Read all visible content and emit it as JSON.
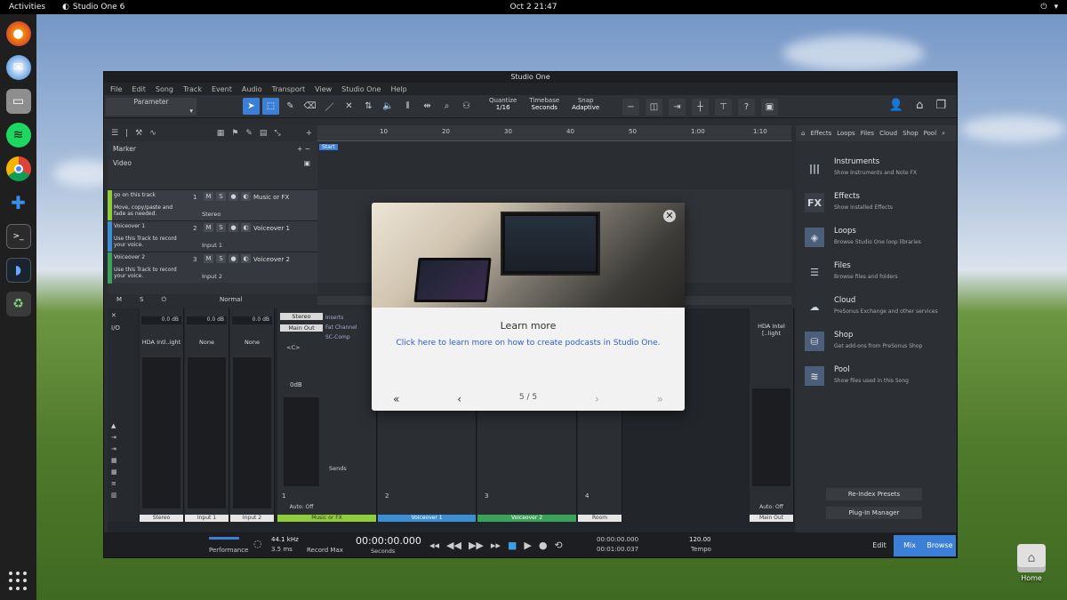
{
  "topbar": {
    "activities": "Activities",
    "app_name": "Studio One 6",
    "clock": "Oct 2  21:47"
  },
  "window": {
    "title": "Studio One",
    "menus": [
      "File",
      "Edit",
      "Song",
      "Track",
      "Event",
      "Audio",
      "Transport",
      "View",
      "Studio One",
      "Help"
    ],
    "parameter_label": "Parameter",
    "quantize": {
      "label": "Quantize",
      "value": "1/16"
    },
    "timebase": {
      "label": "Timebase",
      "value": "Seconds"
    },
    "snap": {
      "label": "Snap",
      "value": "Adaptive"
    }
  },
  "tracks": {
    "marker": "Marker",
    "video": "Video",
    "items": [
      {
        "note": "go on this track\n\nMove, copy/paste and fade as needed.",
        "number": "1",
        "name": "Music or FX",
        "input": "Stereo",
        "color": "#8fce3a"
      },
      {
        "note": "Voiceover 1\n\nUse this Track to record your voice.",
        "number": "2",
        "name": "Voiceover 1",
        "input": "Input 1",
        "color": "#3b8fd4"
      },
      {
        "note": "Voiceover 2\n\nUse this Track to record your voice.",
        "number": "3",
        "name": "Voiceover 2",
        "input": "Input 2",
        "color": "#3aa35a"
      }
    ],
    "footer_mode": "Normal"
  },
  "ruler": {
    "marks": [
      "10",
      "20",
      "30",
      "40",
      "50",
      "1:00",
      "1:10"
    ],
    "start_flag": "Start"
  },
  "browser": {
    "tabs": [
      "Effects",
      "Loops",
      "Files",
      "Cloud",
      "Shop",
      "Pool"
    ],
    "items": [
      {
        "title": "Instruments",
        "subtitle": "Show Instruments and Note FX",
        "icon": "piano-icon",
        "glyph": "|||"
      },
      {
        "title": "Effects",
        "subtitle": "Show installed Effects",
        "icon": "fx-icon",
        "glyph": "FX"
      },
      {
        "title": "Loops",
        "subtitle": "Browse Studio One loop libraries",
        "icon": "loops-icon",
        "glyph": "◈"
      },
      {
        "title": "Files",
        "subtitle": "Browse files and folders",
        "icon": "files-icon",
        "glyph": "☰"
      },
      {
        "title": "Cloud",
        "subtitle": "PreSonus Exchange and other services",
        "icon": "cloud-icon",
        "glyph": "☁"
      },
      {
        "title": "Shop",
        "subtitle": "Get add-ons from PreSonus Shop",
        "icon": "shop-icon",
        "glyph": "⛁"
      },
      {
        "title": "Pool",
        "subtitle": "Show files used in this Song",
        "icon": "pool-icon",
        "glyph": "≋"
      }
    ],
    "reindex": "Re-Index Presets",
    "plugin_manager": "Plug-In Manager"
  },
  "mixer": {
    "channels": [
      {
        "db": "0.0 dB",
        "io": "HDA Intl..ight",
        "label": "Stereo",
        "color": "#e6e6e6"
      },
      {
        "db": "0.0 dB",
        "io": "None",
        "label": "Input 1",
        "color": "#e6e6e6"
      },
      {
        "db": "0.0 dB",
        "io": "None",
        "label": "Input 2",
        "color": "#e6e6e6"
      }
    ],
    "ch1": {
      "input": "Stereo",
      "output": "Main Out",
      "pan": "<C>",
      "gain": "0dB",
      "number": "1",
      "auto": "Auto: Off",
      "label": "Music or FX"
    },
    "inserts": [
      "Inserts",
      "Fat Channel",
      "SC-Comp"
    ],
    "sends": "Sends",
    "strip_labels": [
      {
        "label": "Voiceover 1",
        "number": "2",
        "color": "#3b8fd4"
      },
      {
        "label": "Voiceover 2",
        "number": "3",
        "color": "#3aa35a"
      },
      {
        "label": "Room",
        "number": "4",
        "color": "#e6e6e6"
      }
    ],
    "main": {
      "io": "HDA Intel [..light",
      "auto": "Auto: Off",
      "label": "Main Out"
    }
  },
  "transport": {
    "performance": "Performance",
    "rate": "44.1 kHz",
    "latency": "3.5 ms",
    "record_max": "Record Max",
    "time": "00:00:00.000",
    "time_unit": "Seconds",
    "left": "00:00:00.000",
    "right": "00:01:00.037",
    "tempo_value": "120.00",
    "tempo_label": "Tempo",
    "tabs": [
      "Edit",
      "Mix",
      "Browse"
    ]
  },
  "modal": {
    "title": "Learn more",
    "link": "Click here to learn more on how to create podcasts in Studio One.",
    "page": "5 / 5"
  },
  "desktop": {
    "home_label": "Home"
  }
}
